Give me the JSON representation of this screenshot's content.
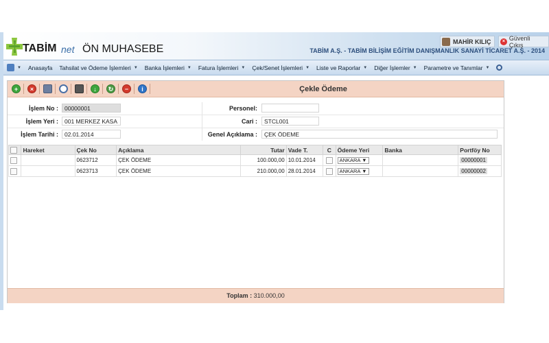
{
  "header": {
    "brand_name": "TABİM",
    "brand_suffix": "net",
    "app_title": "ÖN MUHASEBE",
    "user_name": "MAHİR KILIÇ",
    "logout_label": "Güvenli Çıkış",
    "company_title": "TABİM A.Ş. - TABİM BİLİŞİM EĞİTİM DANIŞMANLIK SANAYİ TİCARET A.Ş. - 2014"
  },
  "nav": {
    "items": [
      "Anasayfa",
      "Tahsilat ve Ödeme İşlemleri",
      "Banka İşlemleri",
      "Fatura İşlemleri",
      "Çek/Senet İşlemleri",
      "Liste ve Raporlar",
      "Diğer İşlemler",
      "Parametre ve Tanımlar"
    ]
  },
  "toolbar": {
    "form_title": "Çekle Ödeme",
    "icons": [
      "add-icon",
      "delete-icon",
      "save-icon",
      "search-icon",
      "print-icon",
      "download-icon",
      "refresh-icon",
      "remove-icon",
      "info-icon"
    ]
  },
  "form": {
    "islem_no_label": "İşlem No :",
    "islem_no_value": "00000001",
    "islem_yeri_label": "İşlem Yeri :",
    "islem_yeri_value": "001 MERKEZ KASA",
    "islem_tarihi_label": "İşlem Tarihi :",
    "islem_tarihi_value": "02.01.2014",
    "personel_label": "Personel:",
    "personel_value": "",
    "cari_label": "Cari :",
    "cari_value": "STCL001",
    "genel_aciklama_label": "Genel Açıklama :",
    "genel_aciklama_value": "ÇEK ÖDEME"
  },
  "table": {
    "headers": [
      "Hareket",
      "Çek No",
      "Açıklama",
      "Tutar",
      "Vade T.",
      "C",
      "Ödeme Yeri",
      "Banka",
      "Portföy No"
    ],
    "rows": [
      {
        "cek_no": "0623712",
        "aciklama": "ÇEK ÖDEME",
        "tutar": "100.000,00",
        "vade": "10.01.2014",
        "odeme_yeri": "ANKARA",
        "banka": "",
        "portfoy_no": "00000001"
      },
      {
        "cek_no": "0623713",
        "aciklama": "ÇEK ÖDEME",
        "tutar": "210.000,00",
        "vade": "28.01.2014",
        "odeme_yeri": "ANKARA",
        "banka": "",
        "portfoy_no": "00000002"
      }
    ]
  },
  "footer": {
    "total_label": "Toplam :",
    "total_value": "310.000,00"
  },
  "colors": {
    "toolbar_bg": "#f4d4c4",
    "nav_bg": "#c8dbee",
    "company_text": "#2d4f7d"
  }
}
